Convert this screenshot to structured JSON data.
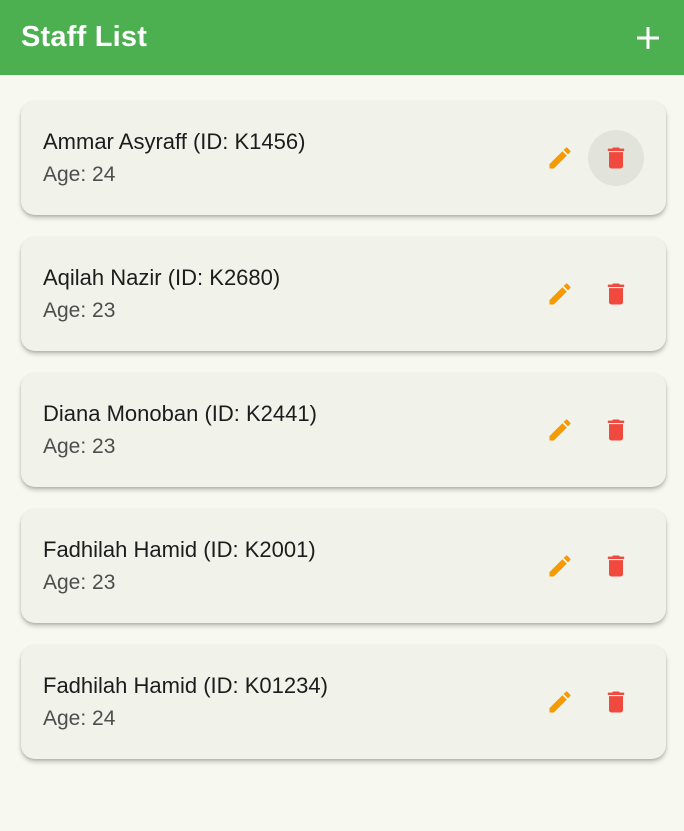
{
  "app_bar": {
    "title": "Staff List",
    "add_icon": "plus-icon",
    "color": "#4caf50"
  },
  "staff": [
    {
      "title": "Ammar Asyraff (ID: K1456)",
      "age": "Age: 24"
    },
    {
      "title": "Aqilah Nazir (ID: K2680)",
      "age": "Age: 23"
    },
    {
      "title": "Diana Monoban (ID: K2441)",
      "age": "Age: 23"
    },
    {
      "title": "Fadhilah Hamid (ID: K2001)",
      "age": "Age: 23"
    },
    {
      "title": "Fadhilah Hamid (ID: K01234)",
      "age": "Age: 24"
    }
  ],
  "icons": {
    "edit": "pencil-icon",
    "delete": "trash-icon",
    "edit_color": "#f59a00",
    "delete_color": "#f04a3e"
  }
}
